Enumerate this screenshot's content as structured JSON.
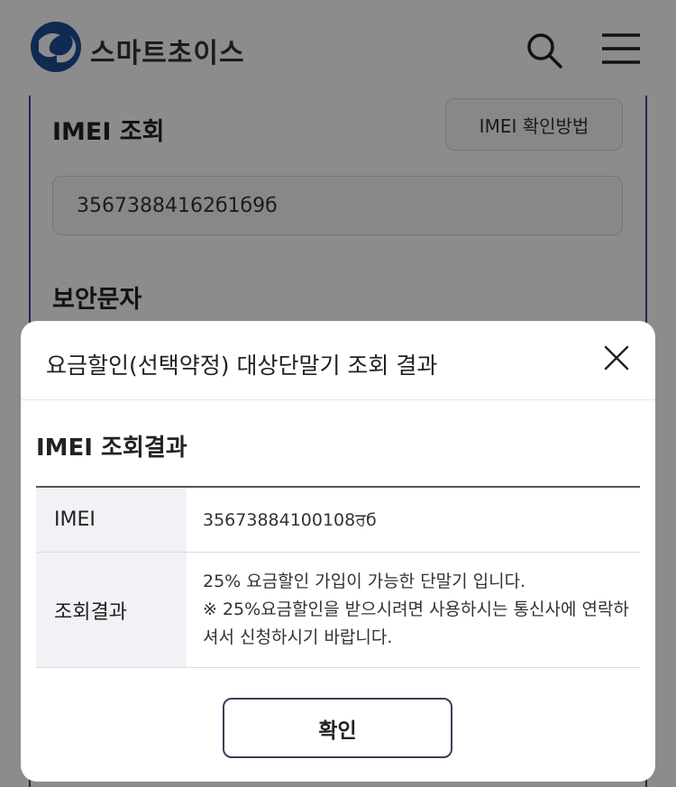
{
  "header": {
    "brand": "스마트초이스",
    "logo_text": "SC"
  },
  "background": {
    "imei_title": "IMEI 조회",
    "imei_howto_label": "IMEI 확인방법",
    "imei_value": "35673884162б1б9б",
    "security_title": "보안문자"
  },
  "modal": {
    "title": "요금할인(선택약정) 대상단말기 조회 결과",
    "section_title": "IMEI 조회결과",
    "rows": [
      {
        "label": "IMEI",
        "value": "35673884100108ਰб"
      },
      {
        "label": "조회결과",
        "line1": "25% 요금할인 가입이 가능한 단말기 입니다.",
        "line2": "※ 25%요금할인을 받으시려면 사용하시는 통신사에 연락하",
        "line3": "셔서 신청하시기 바랍니다."
      }
    ],
    "confirm_label": "확인"
  },
  "colors": {
    "brand_blue": "#1f4e96",
    "card_border": "#3a47a8",
    "overlay": "rgba(0,0,0,0.45)"
  }
}
